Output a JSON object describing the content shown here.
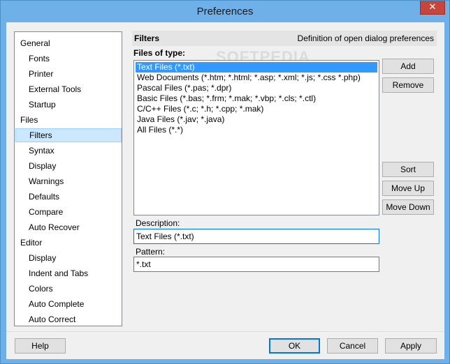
{
  "window": {
    "title": "Preferences",
    "close_glyph": "✕"
  },
  "sidebar": {
    "items": [
      {
        "label": "General",
        "level": 0
      },
      {
        "label": "Fonts",
        "level": 1
      },
      {
        "label": "Printer",
        "level": 1
      },
      {
        "label": "External Tools",
        "level": 1
      },
      {
        "label": "Startup",
        "level": 1
      },
      {
        "label": "Files",
        "level": 0
      },
      {
        "label": "Filters",
        "level": 1,
        "selected": true
      },
      {
        "label": "Syntax",
        "level": 1
      },
      {
        "label": "Display",
        "level": 1
      },
      {
        "label": "Warnings",
        "level": 1
      },
      {
        "label": "Defaults",
        "level": 1
      },
      {
        "label": "Compare",
        "level": 1
      },
      {
        "label": "Auto Recover",
        "level": 1
      },
      {
        "label": "Editor",
        "level": 0
      },
      {
        "label": "Display",
        "level": 1
      },
      {
        "label": "Indent and Tabs",
        "level": 1
      },
      {
        "label": "Colors",
        "level": 1
      },
      {
        "label": "Auto Complete",
        "level": 1
      },
      {
        "label": "Auto Correct",
        "level": 1
      }
    ]
  },
  "panel": {
    "title": "Filters",
    "description": "Definition of open dialog preferences",
    "files_label": "Files of type:",
    "watermark": "SOFTPEDIA",
    "file_types": [
      "Text Files (*.txt)",
      "Web Documents (*.htm; *.html; *.asp; *.xml; *.js; *.css *.php)",
      "Pascal Files (*.pas; *.dpr)",
      "Basic Files (*.bas; *.frm; *.mak; *.vbp; *.cls; *.ctl)",
      "C/C++ Files (*.c; *.h; *.cpp; *.mak)",
      "Java Files (*.jav; *.java)",
      "All Files (*.*)"
    ],
    "selected_index": 0,
    "buttons": {
      "add": "Add",
      "remove": "Remove",
      "sort": "Sort",
      "move_up": "Move Up",
      "move_down": "Move Down"
    },
    "description_label": "Description:",
    "description_value": "Text Files (*.txt)",
    "pattern_label": "Pattern:",
    "pattern_value": "*.txt"
  },
  "footer": {
    "help": "Help",
    "ok": "OK",
    "cancel": "Cancel",
    "apply": "Apply"
  }
}
